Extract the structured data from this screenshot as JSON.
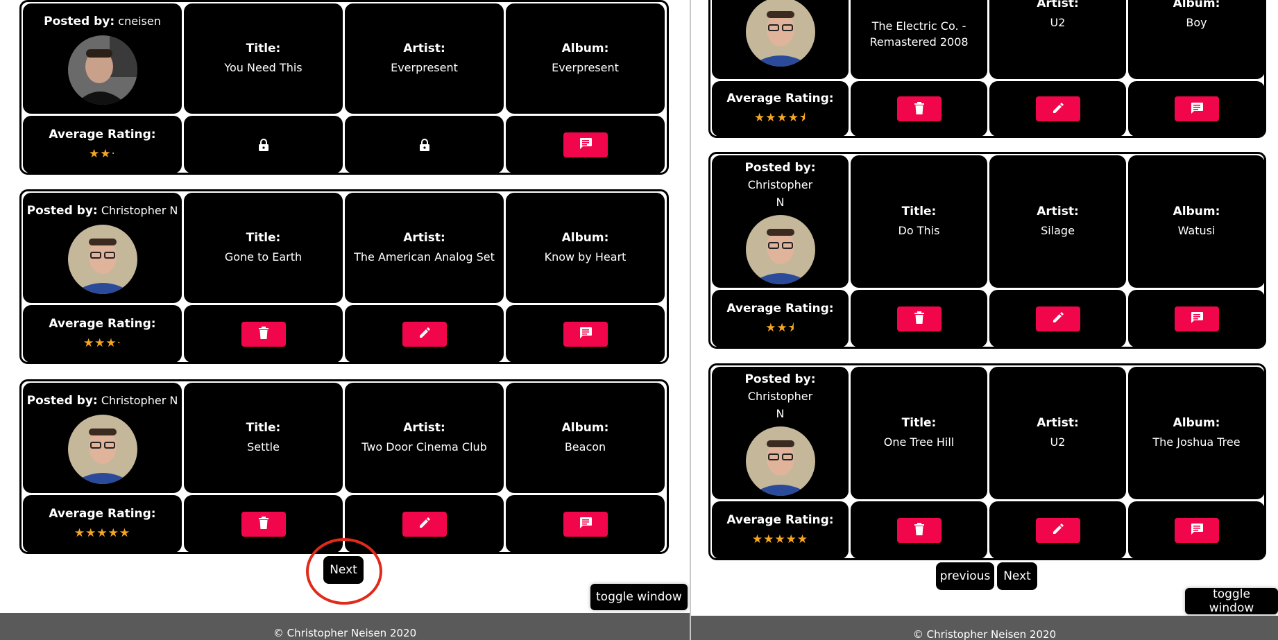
{
  "labels": {
    "posted_by": "Posted by:",
    "title": "Title:",
    "artist": "Artist:",
    "album": "Album:",
    "average_rating": "Average Rating:"
  },
  "left_panel": {
    "posts": [
      {
        "poster": "cneisen",
        "title": "You Need This",
        "artist": "Everpresent",
        "album": "Everpresent",
        "rating": 2.5,
        "stars_text": "★★·",
        "actions": "locked"
      },
      {
        "poster": "Christopher N",
        "title": "Gone to Earth",
        "artist": "The American Analog Set",
        "album": "Know by Heart",
        "rating": 3.5,
        "stars_text": "★★★·",
        "actions": "editable"
      },
      {
        "poster": "Christopher N",
        "title": "Settle",
        "artist": "Two Door Cinema Club",
        "album": "Beacon",
        "rating": 5,
        "stars_text": "★★★★★",
        "actions": "editable"
      }
    ],
    "next_label": "Next",
    "toggle_label": "toggle window",
    "footer_text": "© Christopher Neisen 2020"
  },
  "right_panel": {
    "posts": [
      {
        "poster_line1": "",
        "poster_line2": "",
        "title": "The Electric Co. - Remastered 2008",
        "artist": "U2",
        "album": "Boy",
        "rating": 4.5,
        "stars_text": "★★★★⯨"
      },
      {
        "poster_line1": "Christopher",
        "poster_line2": "N",
        "title": "Do This",
        "artist": "Silage",
        "album": "Watusi",
        "rating": 2.5,
        "stars_text": "★★⯨"
      },
      {
        "poster_line1": "Christopher",
        "poster_line2": "N",
        "title": "One Tree Hill",
        "artist": "U2",
        "album": "The Joshua Tree",
        "rating": 5,
        "stars_text": "★★★★★"
      }
    ],
    "previous_label": "previous",
    "next_label": "Next",
    "toggle_label": "toggle window",
    "footer_text": "© Christopher Neisen 2020"
  },
  "icons": {
    "delete": "trash-icon",
    "edit": "pencil-icon",
    "comment": "comment-icon",
    "locked": "lock-icon"
  },
  "colors": {
    "card": "#000000",
    "action": "#f2064b",
    "star": "#f5a623",
    "footer": "#5a5a5a",
    "highlight": "#e02a1a"
  }
}
